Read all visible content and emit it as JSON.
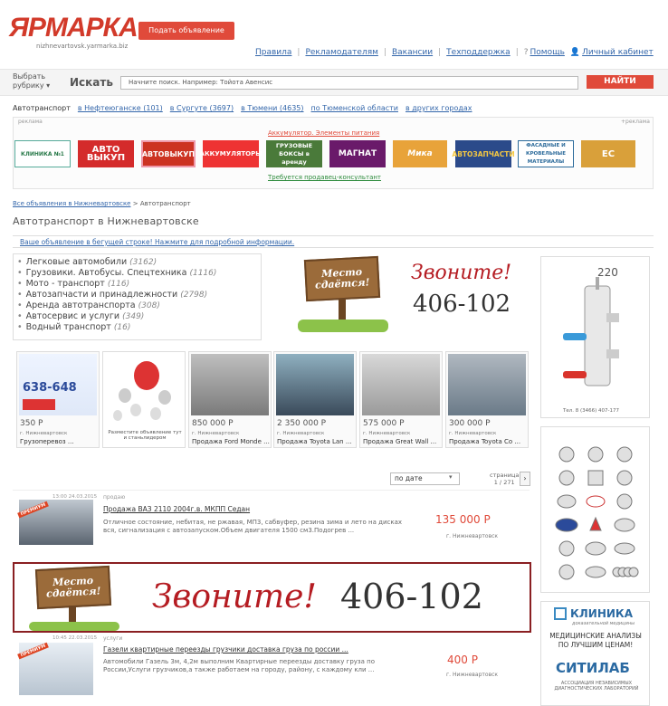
{
  "header": {
    "logo": "ЯРМАРКА",
    "logo_sub": "nizhnevartovsk.yarmarka.biz",
    "post_ad": "Подать объявление",
    "nav": [
      "Правила",
      "Рекламодателям",
      "Вакансии",
      "Техподдержка"
    ],
    "help": "Помощь",
    "cabinet": "Личный кабинет"
  },
  "search": {
    "rubric_line1": "Выбрать",
    "rubric_line2": "рубрику",
    "label": "Искать",
    "placeholder": "Начните поиск. Например: Тойота Авенсис",
    "button": "НАЙТИ"
  },
  "regions": {
    "lead": "Автотранспорт",
    "links": [
      "в Нефтеюганске (101)",
      "в Сургуте (3697)",
      "в Тюмени (4635)",
      "по Тюменской области",
      "в других городах"
    ]
  },
  "strip": {
    "left_small": "реклама",
    "right_small": "+реклама",
    "top_link": "Аккумулятор. Элементы питания",
    "bottom_link": "Требуется продавец-консультант",
    "logos": [
      "КЛИНИКА №1",
      "АВТО ВЫКУП",
      "АВТОВЫКУП",
      "АККУМУЛЯТОРЫ",
      "ГРУЗОВЫЕ БОКСЫ в аренду",
      "МАГНАТ",
      "Мика",
      "АВТОЗАПЧАСТИ",
      "ФАСАДНЫЕ И КРОВЕЛЬНЫЕ МАТЕРИАЛЫ",
      "EC"
    ]
  },
  "breadcrumb": {
    "link": "Все объявления в Нижневартовске",
    "sep": ">",
    "current": "Автотранспорт"
  },
  "page_title": "Автотранспорт в Нижневартовске",
  "ticker": "Ваше объявление в бегущей строке! Нажмите для подробной информации.",
  "categories": [
    {
      "name": "Легковые автомобили",
      "count": "(3162)"
    },
    {
      "name": "Грузовики. Автобусы. Спецтехника",
      "count": "(1116)"
    },
    {
      "name": "Мото - транспорт",
      "count": "(116)"
    },
    {
      "name": "Автозапчасти и принадлежности",
      "count": "(2798)"
    },
    {
      "name": "Аренда автотранспорта",
      "count": "(308)"
    },
    {
      "name": "Автосервис и услуги",
      "count": "(349)"
    },
    {
      "name": "Водный транспорт",
      "count": "(16)"
    }
  ],
  "ad_top": {
    "sign": "Место сдаётся!",
    "call": "Звоните!",
    "phone": "406-102"
  },
  "side_ad1": {
    "number": "220",
    "phone": "Тел. 8 (3466) 407-177"
  },
  "side_ad3": {
    "title": "КЛИНИКА",
    "subtitle": "доказательной медицины",
    "text": "МЕДИЦИНСКИЕ АНАЛИЗЫ ПО ЛУЧШИМ ЦЕНАМ!",
    "brand": "СИТИЛАБ",
    "footer": "АССОЦИАЦИЯ НЕЗАВИСИМЫХ ДИАГНОСТИЧЕСКИХ ЛАБОРАТОРИЙ"
  },
  "tiles": [
    {
      "price": "350 Р",
      "city": "г. Нижневартовск",
      "title": "Грузоперевоз ...",
      "pic_text": "638-648"
    },
    {
      "price": "",
      "city": "",
      "title": "",
      "pic_text": "Разместите объявление тут и станьлидером"
    },
    {
      "price": "850 000 Р",
      "city": "г. Нижневартовск",
      "title": "Продажа Ford Monde ..."
    },
    {
      "price": "2 350 000 Р",
      "city": "г. Нижневартовск",
      "title": "Продажа Toyota Lan ..."
    },
    {
      "price": "575 000 Р",
      "city": "г. Нижневартовск",
      "title": "Продажа Great Wall ..."
    },
    {
      "price": "300 000 Р",
      "city": "г. Нижневартовск",
      "title": "Продажа Toyota Co ..."
    }
  ],
  "sort": {
    "selected": "по дате",
    "page_label": "страница",
    "page_value": "1 / 271",
    "next": "›"
  },
  "listings": [
    {
      "time": "13:00 24.03.2015",
      "category": "продаю",
      "title": "Продажа ВАЗ 2110 2004г.в. МКПП Седан",
      "desc": "Отличное состояние, небитая, не ржавая, МП3, сабвуфер, резина зима и лето на дисках вся, сигнализация с автозапуском.Объем двигателя 1500 см3.Подогрев ...",
      "price": "135 000 Р",
      "city": "г. Нижневартовск",
      "badge": "ПРЕМИУМ"
    },
    {
      "time": "10:45 22.03.2015",
      "category": "услуги",
      "title": "Газели квартирные переезды грузчики доставка груза по россии ...",
      "desc": "Автомобили Газель 3м, 4,2м выполним Квартирные переезды доставку груза по России,Услуги грузчиков,а также работаем на городу, району, с каждому кли ...",
      "price": "400 Р",
      "city": "г. Нижневартовск",
      "badge": "ПРЕМИУМ"
    }
  ],
  "big_banner": {
    "sign": "Место сдаётся!",
    "call": "Звоните!",
    "phone": "406-102"
  }
}
